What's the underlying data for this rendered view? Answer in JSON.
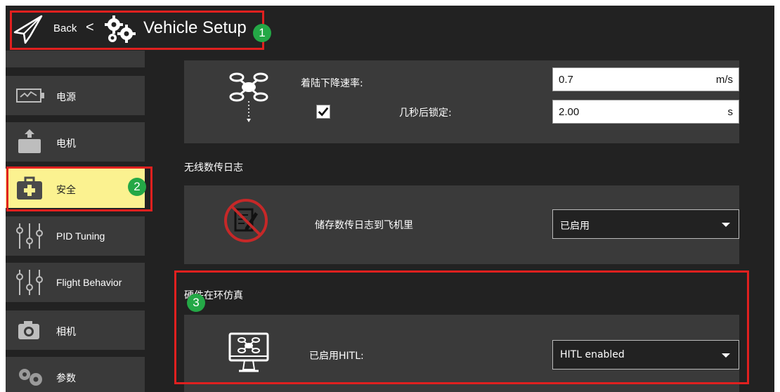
{
  "header": {
    "back_label": "Back",
    "separator": "<",
    "title": "Vehicle Setup"
  },
  "sidebar": {
    "items": [
      {
        "label": "电源",
        "icon": "battery-icon"
      },
      {
        "label": "电机",
        "icon": "motor-icon"
      },
      {
        "label": "安全",
        "icon": "medkit-icon",
        "active": true
      },
      {
        "label": "PID Tuning",
        "icon": "sliders-icon"
      },
      {
        "label": "Flight Behavior",
        "icon": "sliders-icon"
      },
      {
        "label": "相机",
        "icon": "camera-icon"
      },
      {
        "label": "参数",
        "icon": "gears-icon"
      }
    ]
  },
  "land": {
    "descent_rate_label": "着陆下降速率:",
    "descent_rate_value": "0.7",
    "descent_rate_unit": "m/s",
    "disarm_label": "几秒后锁定:",
    "disarm_value": "2.00",
    "disarm_unit": "s",
    "disarm_checked": true
  },
  "telemetry": {
    "section_title": "无线数传日志",
    "save_label": "储存数传日志到飞机里",
    "save_value": "已启用"
  },
  "hitl": {
    "section_title": "硬件在环仿真",
    "label": "已启用HITL:",
    "value": "HITL enabled"
  },
  "annotations": [
    "1",
    "2",
    "3"
  ],
  "colors": {
    "background": "#222222",
    "panel": "#3a3a3a",
    "active_item": "#fbf290",
    "annotation_box": "#e0201f",
    "annotation_badge": "#24a846"
  }
}
